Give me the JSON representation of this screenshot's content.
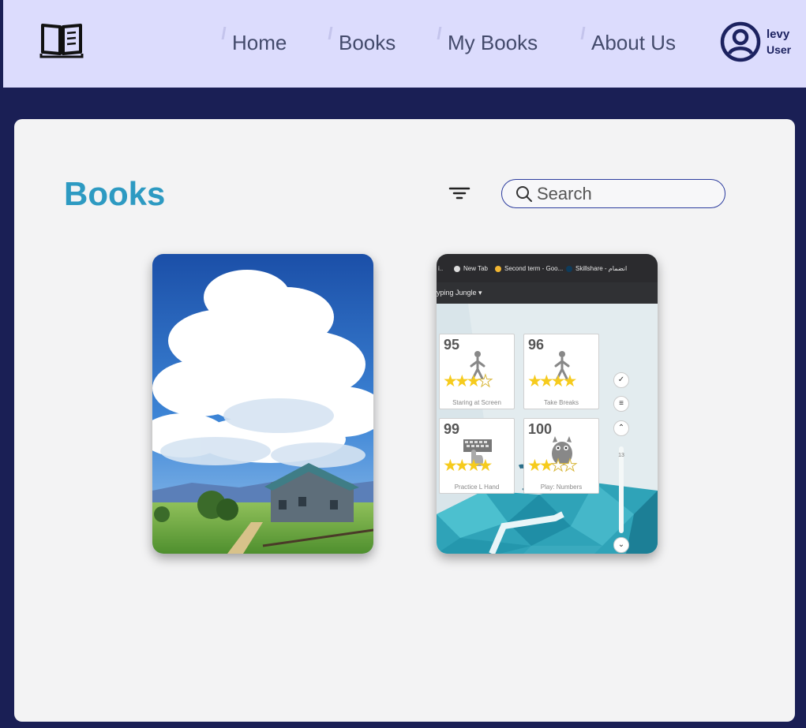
{
  "nav": {
    "logo_icon": "open-book-icon",
    "links": [
      "Home",
      "Books",
      "My Books",
      "About Us"
    ],
    "user": {
      "name": "levy",
      "role": "User",
      "icon": "user-circle-icon"
    }
  },
  "main": {
    "title": "Books",
    "filter_icon": "filter-icon",
    "search": {
      "placeholder": "Search",
      "value": ""
    },
    "books": [
      {
        "cover": "anime landscape: clouds over a farmhouse"
      },
      {
        "cover": "screenshot of typing lessons",
        "browser_tabs": [
          "New Tab",
          "Second term - Goo...",
          "Skillshare - انضمام"
        ],
        "toolbar_label": "yping Jungle",
        "side_number": "13",
        "lessons": [
          {
            "number": "95",
            "caption": "Staring at Screen",
            "stars": 3
          },
          {
            "number": "96",
            "caption": "Take Breaks",
            "stars": 4
          },
          {
            "number": "99",
            "caption": "Practice L Hand",
            "stars": 4
          },
          {
            "number": "100",
            "caption": "Play: Numbers",
            "stars": 2
          }
        ]
      }
    ]
  },
  "colors": {
    "nav_bg": "#dcdcfd",
    "page_bg": "#1a1f55",
    "panel_bg": "#f3f3f4",
    "title": "#2d9ac2",
    "accent": "#1c2260"
  }
}
